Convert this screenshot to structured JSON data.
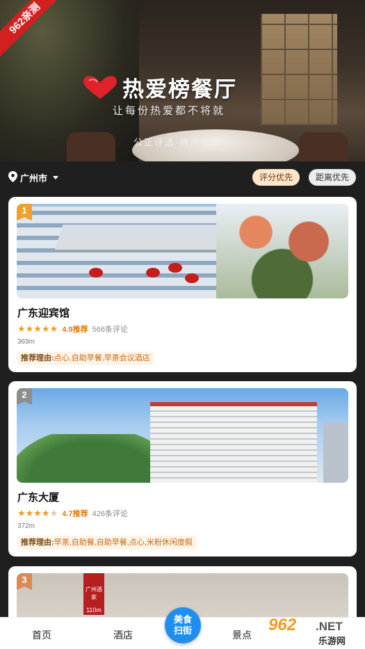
{
  "banner": {
    "ribbon": "962亲测",
    "title": "热爱榜餐厅",
    "subtitle": "让每份热爱都不将就",
    "tagline": "公正评选·用户喜爱"
  },
  "filter": {
    "city": "广州市",
    "sort_active": "评分优先",
    "sort_other": "距离优先"
  },
  "restaurants": [
    {
      "rank": "1",
      "name": "广东迎宾馆",
      "stars": 5,
      "score": "4.9推荐",
      "reviews": "566条评论",
      "distance": "369m",
      "reason_label": "推荐理由:",
      "reason_text": "点心,自助早餐,早茶会议酒店"
    },
    {
      "rank": "2",
      "name": "广东大厦",
      "stars": 4.5,
      "score": "4.7推荐",
      "reviews": "426条评论",
      "distance": "372m",
      "reason_label": "推荐理由:",
      "reason_text": "早茶,自助餐,自助早餐,点心,米粉休闲度假"
    },
    {
      "rank": "3",
      "sign_text": "广州酒家",
      "sign_distance": "110m"
    }
  ],
  "tabbar": {
    "home": "首页",
    "hotel": "酒店",
    "center_line1": "美食",
    "center_line2": "扫街",
    "scenic": "景点"
  },
  "watermark": {
    "num": "962",
    "net": ".NET",
    "cn": "乐游网"
  },
  "colors": {
    "accent_orange": "#f39a1e",
    "rank1": "#f0a02a",
    "rank2": "#8d8d8d",
    "rank3": "#d98a55",
    "tab_center": "#1e8ff0",
    "ribbon_red": "#d41f1f"
  }
}
